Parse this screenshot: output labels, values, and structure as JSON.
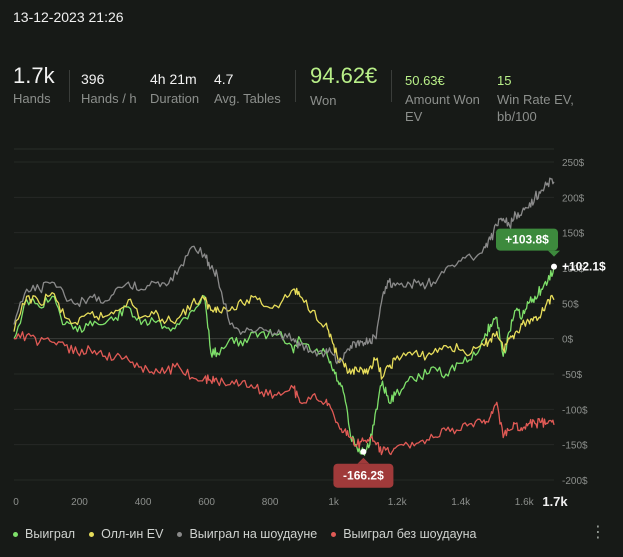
{
  "datetime": "13-12-2023 21:26",
  "stats": {
    "hands": {
      "value": "1.7k",
      "label": "Hands"
    },
    "hands_per_hour": {
      "value": "396",
      "label": "Hands / h"
    },
    "duration": {
      "value": "4h 21m",
      "label": "Duration"
    },
    "avg_tables": {
      "value": "4.7",
      "label": "Avg. Tables"
    },
    "won": {
      "value": "94.62€",
      "label": "Won"
    },
    "amount_won_ev": {
      "value": "50.63€",
      "label_line1": "Amount Won",
      "label_line2": "EV"
    },
    "win_rate_ev": {
      "value": "15",
      "label_line1": "Win Rate EV,",
      "label_line2": "bb/100"
    }
  },
  "colors": {
    "won_line": "#7ee06a",
    "allin_ev": "#e6dc5a",
    "showdown": "#8a8a8a",
    "non_showdown": "#e05a55",
    "accent_green_tag": "#3d8a3d",
    "accent_red_tag": "#a03a3a"
  },
  "chart_data": {
    "type": "line",
    "x_ticks": [
      "0",
      "200",
      "400",
      "600",
      "800",
      "1k",
      "1.2k",
      "1.4k",
      "1.6k"
    ],
    "x_end_label": "1.7k",
    "xlim": [
      0,
      1700
    ],
    "y_ticks": [
      "250$",
      "200$",
      "150$",
      "100$",
      "50$",
      "0$",
      "-50$",
      "-100$",
      "-150$",
      "-200$"
    ],
    "ylim": [
      -200,
      250
    ],
    "grid": "horizontal",
    "max_annotation": "+103.8$",
    "min_annotation": "-166.2$",
    "end_label": "+102.1$",
    "series": [
      {
        "name": "Выиграл",
        "color_key": "won_line",
        "x": [
          0,
          40,
          80,
          120,
          160,
          200,
          240,
          280,
          320,
          360,
          400,
          440,
          480,
          520,
          560,
          600,
          620,
          640,
          680,
          720,
          760,
          800,
          840,
          880,
          900,
          940,
          980,
          1000,
          1020,
          1040,
          1060,
          1080,
          1100,
          1120,
          1140,
          1160,
          1180,
          1200,
          1240,
          1280,
          1320,
          1360,
          1400,
          1440,
          1480,
          1500,
          1520,
          1540,
          1560,
          1580,
          1600,
          1620,
          1640,
          1660,
          1680,
          1700
        ],
        "values": [
          0,
          55,
          45,
          60,
          20,
          10,
          25,
          20,
          30,
          45,
          20,
          25,
          15,
          20,
          40,
          60,
          -20,
          -20,
          0,
          -10,
          10,
          5,
          10,
          -20,
          0,
          -20,
          -20,
          -40,
          -60,
          -80,
          -140,
          -155,
          -160,
          -150,
          -100,
          -60,
          -90,
          -80,
          -60,
          -55,
          -40,
          -50,
          -35,
          -30,
          0,
          20,
          30,
          -25,
          10,
          40,
          30,
          50,
          60,
          70,
          80,
          102
        ]
      },
      {
        "name": "Олл-ин EV",
        "color_key": "allin_ev",
        "x": [
          0,
          40,
          80,
          120,
          160,
          200,
          240,
          280,
          320,
          360,
          400,
          440,
          480,
          520,
          560,
          600,
          620,
          640,
          680,
          720,
          760,
          800,
          840,
          880,
          900,
          940,
          980,
          1000,
          1020,
          1040,
          1060,
          1080,
          1100,
          1120,
          1140,
          1160,
          1180,
          1200,
          1240,
          1280,
          1320,
          1360,
          1400,
          1440,
          1480,
          1500,
          1520,
          1540,
          1560,
          1580,
          1600,
          1620,
          1640,
          1660,
          1680,
          1700
        ],
        "values": [
          10,
          60,
          50,
          65,
          30,
          20,
          35,
          30,
          40,
          55,
          30,
          35,
          25,
          30,
          50,
          55,
          40,
          45,
          40,
          50,
          60,
          45,
          50,
          70,
          60,
          40,
          20,
          0,
          -30,
          -40,
          -50,
          -45,
          -50,
          -40,
          -30,
          -55,
          -40,
          -30,
          -20,
          -25,
          -20,
          -10,
          -15,
          -20,
          -10,
          0,
          10,
          -15,
          0,
          10,
          20,
          25,
          30,
          35,
          55,
          55
        ]
      },
      {
        "name": "Выиграл на шоудауне",
        "color_key": "showdown",
        "x": [
          0,
          40,
          80,
          120,
          160,
          200,
          240,
          280,
          320,
          360,
          400,
          440,
          480,
          520,
          560,
          600,
          620,
          640,
          680,
          720,
          760,
          800,
          840,
          880,
          900,
          940,
          980,
          1000,
          1020,
          1040,
          1060,
          1080,
          1100,
          1120,
          1140,
          1160,
          1180,
          1200,
          1240,
          1280,
          1320,
          1360,
          1400,
          1440,
          1480,
          1500,
          1520,
          1540,
          1560,
          1580,
          1600,
          1620,
          1640,
          1660,
          1680,
          1700
        ],
        "values": [
          20,
          70,
          70,
          80,
          60,
          50,
          60,
          50,
          70,
          80,
          70,
          80,
          75,
          100,
          130,
          120,
          100,
          90,
          20,
          10,
          10,
          10,
          5,
          0,
          -10,
          -20,
          -20,
          -20,
          -30,
          -20,
          -10,
          -5,
          -10,
          0,
          0,
          60,
          80,
          75,
          80,
          75,
          80,
          100,
          110,
          115,
          130,
          140,
          160,
          170,
          160,
          175,
          180,
          185,
          200,
          210,
          220,
          222
        ]
      },
      {
        "name": "Выиграл без шоудауна",
        "color_key": "non_showdown",
        "x": [
          0,
          40,
          80,
          120,
          160,
          200,
          240,
          280,
          320,
          360,
          400,
          440,
          480,
          520,
          560,
          600,
          620,
          640,
          680,
          720,
          760,
          800,
          840,
          880,
          900,
          940,
          980,
          1000,
          1020,
          1040,
          1060,
          1080,
          1100,
          1120,
          1140,
          1160,
          1180,
          1200,
          1240,
          1280,
          1320,
          1360,
          1400,
          1440,
          1480,
          1500,
          1520,
          1540,
          1560,
          1580,
          1600,
          1620,
          1640,
          1660,
          1680,
          1700
        ],
        "values": [
          0,
          5,
          -5,
          -5,
          -10,
          -20,
          -15,
          -25,
          -25,
          -30,
          -40,
          -50,
          -45,
          -40,
          -55,
          -55,
          -60,
          -60,
          -65,
          -60,
          -70,
          -80,
          -80,
          -70,
          -90,
          -80,
          -90,
          -100,
          -120,
          -130,
          -140,
          -150,
          -145,
          -140,
          -150,
          -160,
          -160,
          -155,
          -150,
          -145,
          -140,
          -130,
          -130,
          -120,
          -115,
          -110,
          -90,
          -140,
          -130,
          -120,
          -130,
          -120,
          -120,
          -118,
          -120,
          -122
        ]
      }
    ]
  },
  "legend": [
    {
      "label": "Выиграл",
      "color_key": "won_line"
    },
    {
      "label": "Олл-ин EV",
      "color_key": "allin_ev"
    },
    {
      "label": "Выиграл на шоудауне",
      "color_key": "showdown"
    },
    {
      "label": "Выиграл без шоудауна",
      "color_key": "non_showdown"
    }
  ],
  "menu_icon": "kebab-menu-icon"
}
